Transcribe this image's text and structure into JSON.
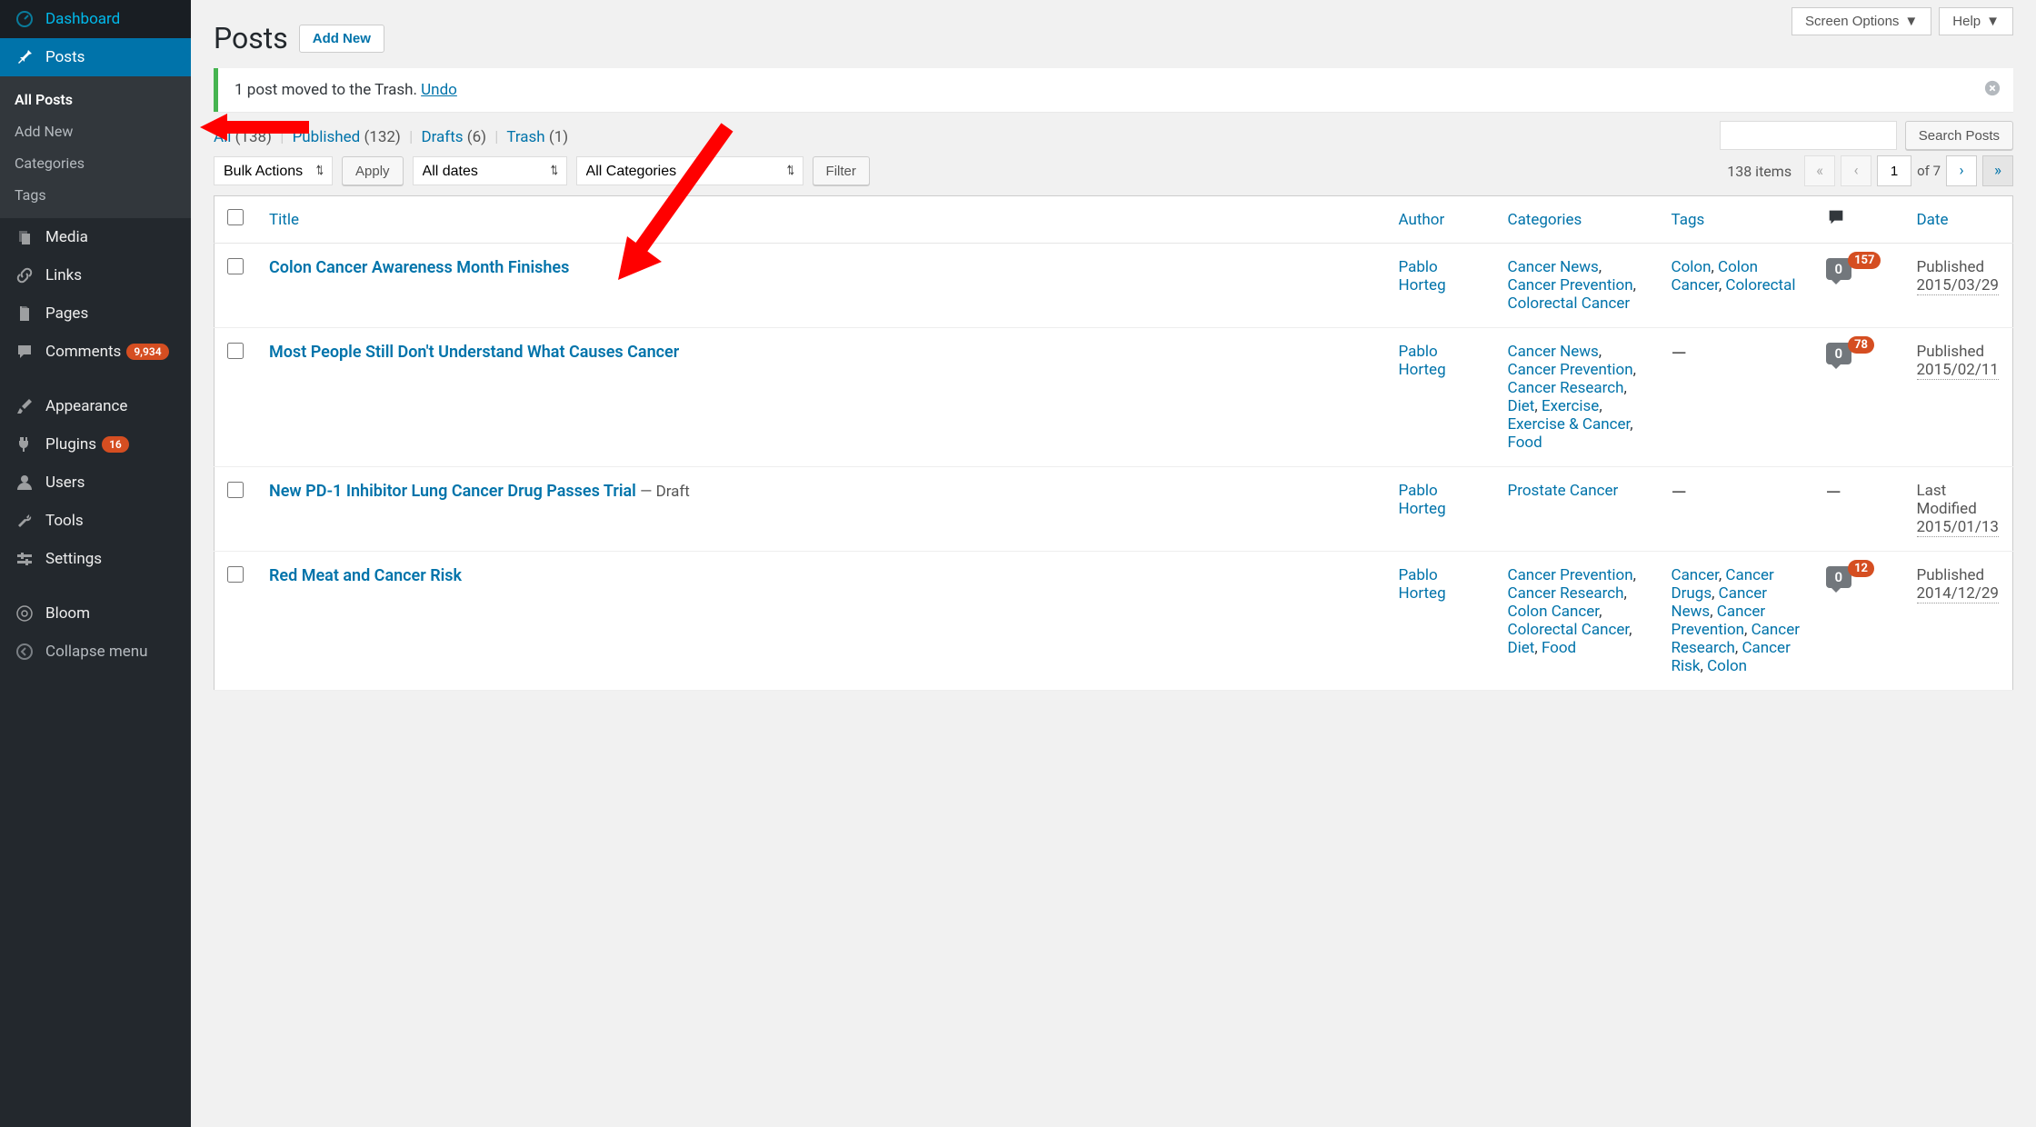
{
  "sidebar": {
    "items": [
      {
        "label": "Dashboard",
        "icon": "dashboard"
      },
      {
        "label": "Posts",
        "icon": "pin",
        "current": true
      },
      {
        "label": "Media",
        "icon": "media"
      },
      {
        "label": "Links",
        "icon": "link"
      },
      {
        "label": "Pages",
        "icon": "page"
      },
      {
        "label": "Comments",
        "icon": "comment",
        "badge": "9,934"
      },
      {
        "label": "Appearance",
        "icon": "brush"
      },
      {
        "label": "Plugins",
        "icon": "plug",
        "badge": "16"
      },
      {
        "label": "Users",
        "icon": "user"
      },
      {
        "label": "Tools",
        "icon": "wrench"
      },
      {
        "label": "Settings",
        "icon": "settings"
      },
      {
        "label": "Bloom",
        "icon": "bloom"
      }
    ],
    "sub": [
      {
        "label": "All Posts",
        "current": true
      },
      {
        "label": "Add New"
      },
      {
        "label": "Categories"
      },
      {
        "label": "Tags"
      }
    ],
    "collapse": "Collapse menu"
  },
  "top": {
    "screen_options": "Screen Options",
    "help": "Help"
  },
  "header": {
    "title": "Posts",
    "add_new": "Add New"
  },
  "notice": {
    "text": "1 post moved to the Trash. ",
    "undo": "Undo"
  },
  "filters": {
    "all": "All",
    "all_count": "(138)",
    "published": "Published",
    "published_count": "(132)",
    "drafts": "Drafts",
    "drafts_count": "(6)",
    "trash": "Trash",
    "trash_count": "(1)"
  },
  "search": {
    "button": "Search Posts"
  },
  "tablenav": {
    "bulk": "Bulk Actions",
    "apply": "Apply",
    "dates": "All dates",
    "categories": "All Categories",
    "filter": "Filter",
    "items": "138 items",
    "page": "1",
    "of": "of 7"
  },
  "columns": {
    "title": "Title",
    "author": "Author",
    "categories": "Categories",
    "tags": "Tags",
    "date": "Date"
  },
  "rows": [
    {
      "title": "Colon Cancer Awareness Month Finishes",
      "author": "Pablo Horteg",
      "cats": [
        "Cancer News",
        "Cancer Prevention",
        "Colorectal Cancer"
      ],
      "tags": [
        "Colon",
        "Colon Cancer",
        "Colorectal"
      ],
      "comments": "0",
      "pending": "157",
      "status": "Published",
      "date": "2015/03/29"
    },
    {
      "title": "Most People Still Don't Understand What Causes Cancer",
      "author": "Pablo Horteg",
      "cats": [
        "Cancer News",
        "Cancer Prevention",
        "Cancer Research",
        "Diet",
        "Exercise",
        "Exercise & Cancer",
        "Food"
      ],
      "tags": null,
      "comments": "0",
      "pending": "78",
      "status": "Published",
      "date": "2015/02/11"
    },
    {
      "title": "New PD-1 Inhibitor Lung Cancer Drug Passes Trial",
      "state": " — Draft",
      "author": "Pablo Horteg",
      "cats": [
        "Prostate Cancer"
      ],
      "tags": null,
      "comments": null,
      "status": "Last Modified",
      "date": "2015/01/13"
    },
    {
      "title": "Red Meat and Cancer Risk",
      "author": "Pablo Horteg",
      "cats": [
        "Cancer Prevention",
        "Cancer Research",
        "Colon Cancer",
        "Colorectal Cancer",
        "Diet",
        "Food"
      ],
      "tags": [
        "Cancer",
        "Cancer Drugs",
        "Cancer News",
        "Cancer Prevention",
        "Cancer Research",
        "Cancer Risk",
        "Colon"
      ],
      "comments": "0",
      "pending": "12",
      "status": "Published",
      "date": "2014/12/29"
    }
  ]
}
